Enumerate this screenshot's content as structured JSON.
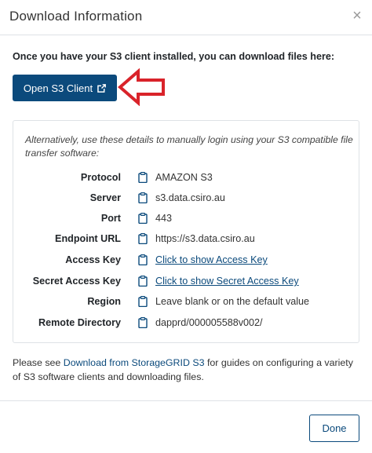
{
  "dialog": {
    "title": "Download Information",
    "close_label": "×"
  },
  "intro": "Once you have your S3 client installed, you can download files here:",
  "open_button": {
    "label": "Open S3 Client",
    "icon": "external-link-icon",
    "color": "#0b4a7c"
  },
  "details": {
    "alt_text": "Alternatively, use these details to manually login using your S3 compatible file transfer software:",
    "rows": [
      {
        "label": "Protocol",
        "value": "AMAZON S3"
      },
      {
        "label": "Server",
        "value": "s3.data.csiro.au"
      },
      {
        "label": "Port",
        "value": "443"
      },
      {
        "label": "Endpoint URL",
        "value": "https://s3.data.csiro.au"
      },
      {
        "label": "Access Key",
        "value": "Click to show Access Key"
      },
      {
        "label": "Secret Access Key",
        "value": "Click to show Secret Access Key"
      },
      {
        "label": "Region",
        "value": "Leave blank or on the default value"
      },
      {
        "label": "Remote Directory",
        "value": "dapprd/000005588v002/"
      }
    ]
  },
  "footer_text": {
    "before": "Please see ",
    "link": "Download from StorageGRID S3",
    "after": " for guides on configuring a variety of S3 software clients and downloading files."
  },
  "done_button": {
    "label": "Done"
  },
  "annotation": {
    "arrow_color": "#d9232a"
  }
}
